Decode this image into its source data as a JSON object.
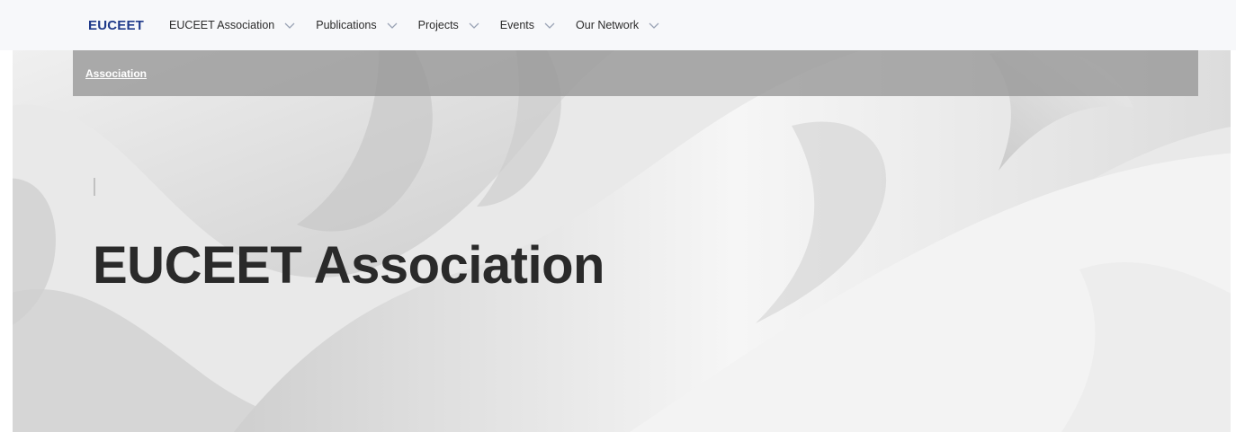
{
  "header": {
    "brand": "EUCEET",
    "nav": [
      {
        "label": "EUCEET Association",
        "icon": "chevron-down-icon"
      },
      {
        "label": "Publications",
        "icon": "chevron-down-icon"
      },
      {
        "label": "Projects",
        "icon": "chevron-down-icon"
      },
      {
        "label": "Events",
        "icon": "chevron-down-icon"
      },
      {
        "label": "Our Network",
        "icon": "chevron-down-icon"
      }
    ]
  },
  "breadcrumb": {
    "current": "Association"
  },
  "hero": {
    "title": "EUCEET Association"
  },
  "colors": {
    "brand": "#1f3a8a",
    "nav_background": "#f7f8fa",
    "breadcrumb_background": "#969696",
    "title_text": "#2a2a2a"
  }
}
